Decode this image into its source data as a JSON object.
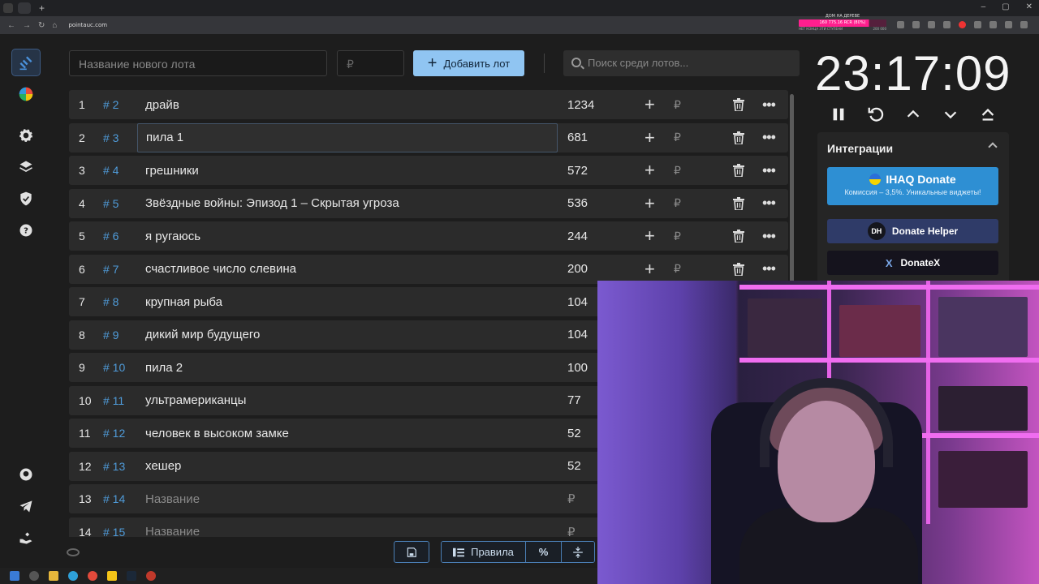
{
  "browser": {
    "url": "pointauc.com",
    "promo": {
      "title": "ДОМ НА ДЕРЕВЕ",
      "progress_text": "160 775.16 RCR (80%)",
      "progress": 0.8,
      "left_label": "НЕТ КОНЦА ЭТИ СТУПЕНИ",
      "right_label": "200 000"
    }
  },
  "sidebar": {
    "items": [
      "auction-icon",
      "pie-chart-icon",
      "gear-icon",
      "layers-icon",
      "shield-icon",
      "help-icon"
    ],
    "bottom": [
      "github-icon",
      "telegram-icon",
      "donate-hand-icon"
    ]
  },
  "topbar": {
    "lot_name_placeholder": "Название нового лота",
    "amount_placeholder": "₽",
    "add_button_label": "Добавить лот",
    "search_placeholder": "Поиск среди лотов..."
  },
  "lots": [
    {
      "num": "1",
      "id": "# 2",
      "name": "драйв",
      "amount": "1234"
    },
    {
      "num": "2",
      "id": "# 3",
      "name": "пила 1",
      "amount": "681"
    },
    {
      "num": "3",
      "id": "# 4",
      "name": "грешники",
      "amount": "572"
    },
    {
      "num": "4",
      "id": "# 5",
      "name": "Звёздные войны: Эпизод 1 – Скрытая угроза",
      "amount": "536"
    },
    {
      "num": "5",
      "id": "# 6",
      "name": "я ругаюсь",
      "amount": "244"
    },
    {
      "num": "6",
      "id": "# 7",
      "name": "счастливое число слевина",
      "amount": "200"
    },
    {
      "num": "7",
      "id": "# 8",
      "name": "крупная рыба",
      "amount": "104"
    },
    {
      "num": "8",
      "id": "# 9",
      "name": "дикий мир будущего",
      "amount": "104"
    },
    {
      "num": "9",
      "id": "# 10",
      "name": "пила 2",
      "amount": "100"
    },
    {
      "num": "10",
      "id": "# 11",
      "name": "ультрамериканцы",
      "amount": "77"
    },
    {
      "num": "11",
      "id": "# 12",
      "name": "человек в высоком замке",
      "amount": "52"
    },
    {
      "num": "12",
      "id": "# 13",
      "name": "хешер",
      "amount": "52"
    },
    {
      "num": "13",
      "id": "# 14",
      "name": "Название",
      "amount": "₽"
    },
    {
      "num": "14",
      "id": "# 15",
      "name": "Название",
      "amount": "₽"
    }
  ],
  "row_actions": {
    "plus": "+",
    "rub": "₽",
    "more": "•••"
  },
  "bottombar": {
    "rules_label": "Правила",
    "percent_label": "%"
  },
  "timer": {
    "value": "23:17:09"
  },
  "integrations": {
    "title": "Интеграции",
    "ihaq_title": "IHAQ Donate",
    "ihaq_subtitle": "Комиссия – 3,5%. Уникальные виджеты!",
    "donate_helper_logo": "DH",
    "donate_helper": "Donate Helper",
    "donatex_logo": "X",
    "donatex": "DonateX"
  },
  "colors": {
    "accent": "#90c5f2",
    "id_color": "#4f9bd9",
    "ihaq": "#2e8fd3",
    "donate_helper": "#2f3b68"
  }
}
